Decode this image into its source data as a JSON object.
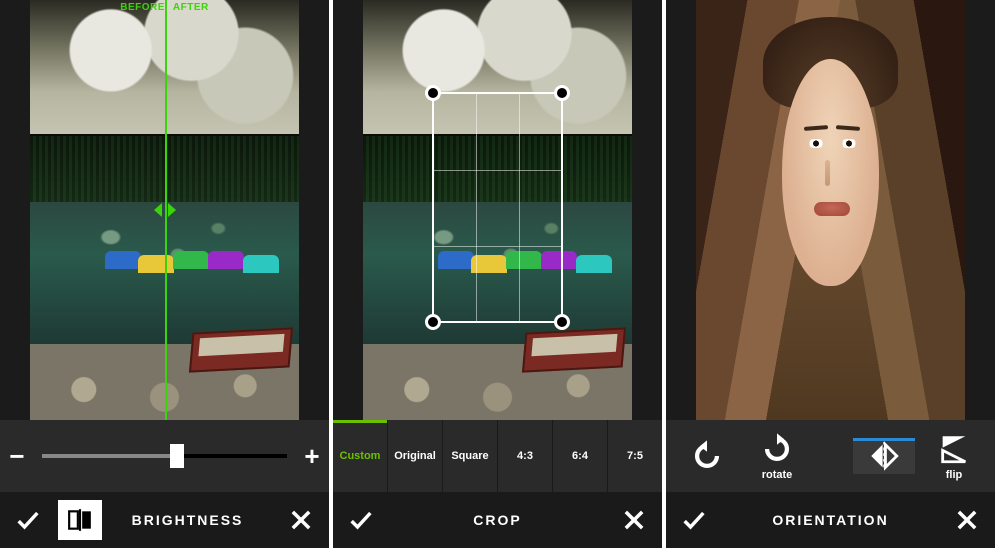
{
  "accent_green": "#6ac000",
  "accent_blue": "#2a8ad8",
  "before_after": {
    "before": "BEFORE",
    "after": "AFTER"
  },
  "slider": {
    "minus": "−",
    "plus": "+",
    "value_percent": 55
  },
  "panel1": {
    "title": "BRIGHTNESS"
  },
  "panel2": {
    "title": "CROP",
    "ratios": [
      "Custom",
      "Original",
      "Square",
      "4:3",
      "6:4",
      "7:5"
    ],
    "selected_index": 0
  },
  "panel3": {
    "title": "ORIENTATION",
    "rotate_label": "rotate",
    "flip_label": "flip",
    "selected": "flip-h"
  }
}
